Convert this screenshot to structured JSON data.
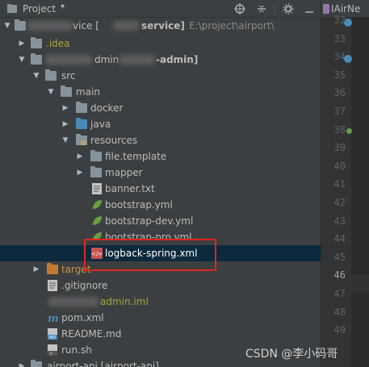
{
  "toolbar": {
    "title": "Project",
    "icons": [
      "project-icon",
      "dropdown-caret-icon",
      "locate-icon",
      "collapse-icon",
      "settings-icon",
      "hide-icon"
    ]
  },
  "tree": {
    "root": {
      "label_a": "vice [",
      "label_b": "service]",
      "path": "E:\\project\\airport\\"
    },
    "idea": ".idea",
    "module": {
      "label_a": "dmin",
      "label_b": "-admin]"
    },
    "src": "src",
    "main": "main",
    "docker": "docker",
    "java": "java",
    "resources": "resources",
    "file_template": "file.template",
    "mapper": "mapper",
    "banner": "banner.txt",
    "bootstrap": "bootstrap.yml",
    "bootstrap_dev": "bootstrap-dev.yml",
    "bootstrap_pro": "bootstrap-pro.yml",
    "logback": "logback-spring.xml",
    "target": "target",
    "gitignore": ".gitignore",
    "iml": "admin.iml",
    "pom": "pom.xml",
    "readme": "README.md",
    "run": "run.sh",
    "airport_api": "airport-api [airport-api]"
  },
  "editor": {
    "tab": "IAirNe",
    "line_numbers": [
      "32",
      "33",
      "34",
      "35",
      "36",
      "37",
      "38",
      "39",
      "40",
      "41",
      "42",
      "43",
      "44",
      "45",
      "46",
      "47",
      "48",
      "49"
    ]
  },
  "watermark": "CSDN @李小码哥",
  "colors": {
    "selection": "#0d293e",
    "highlight_box": "#e0261d",
    "background": "#3c3f41"
  }
}
